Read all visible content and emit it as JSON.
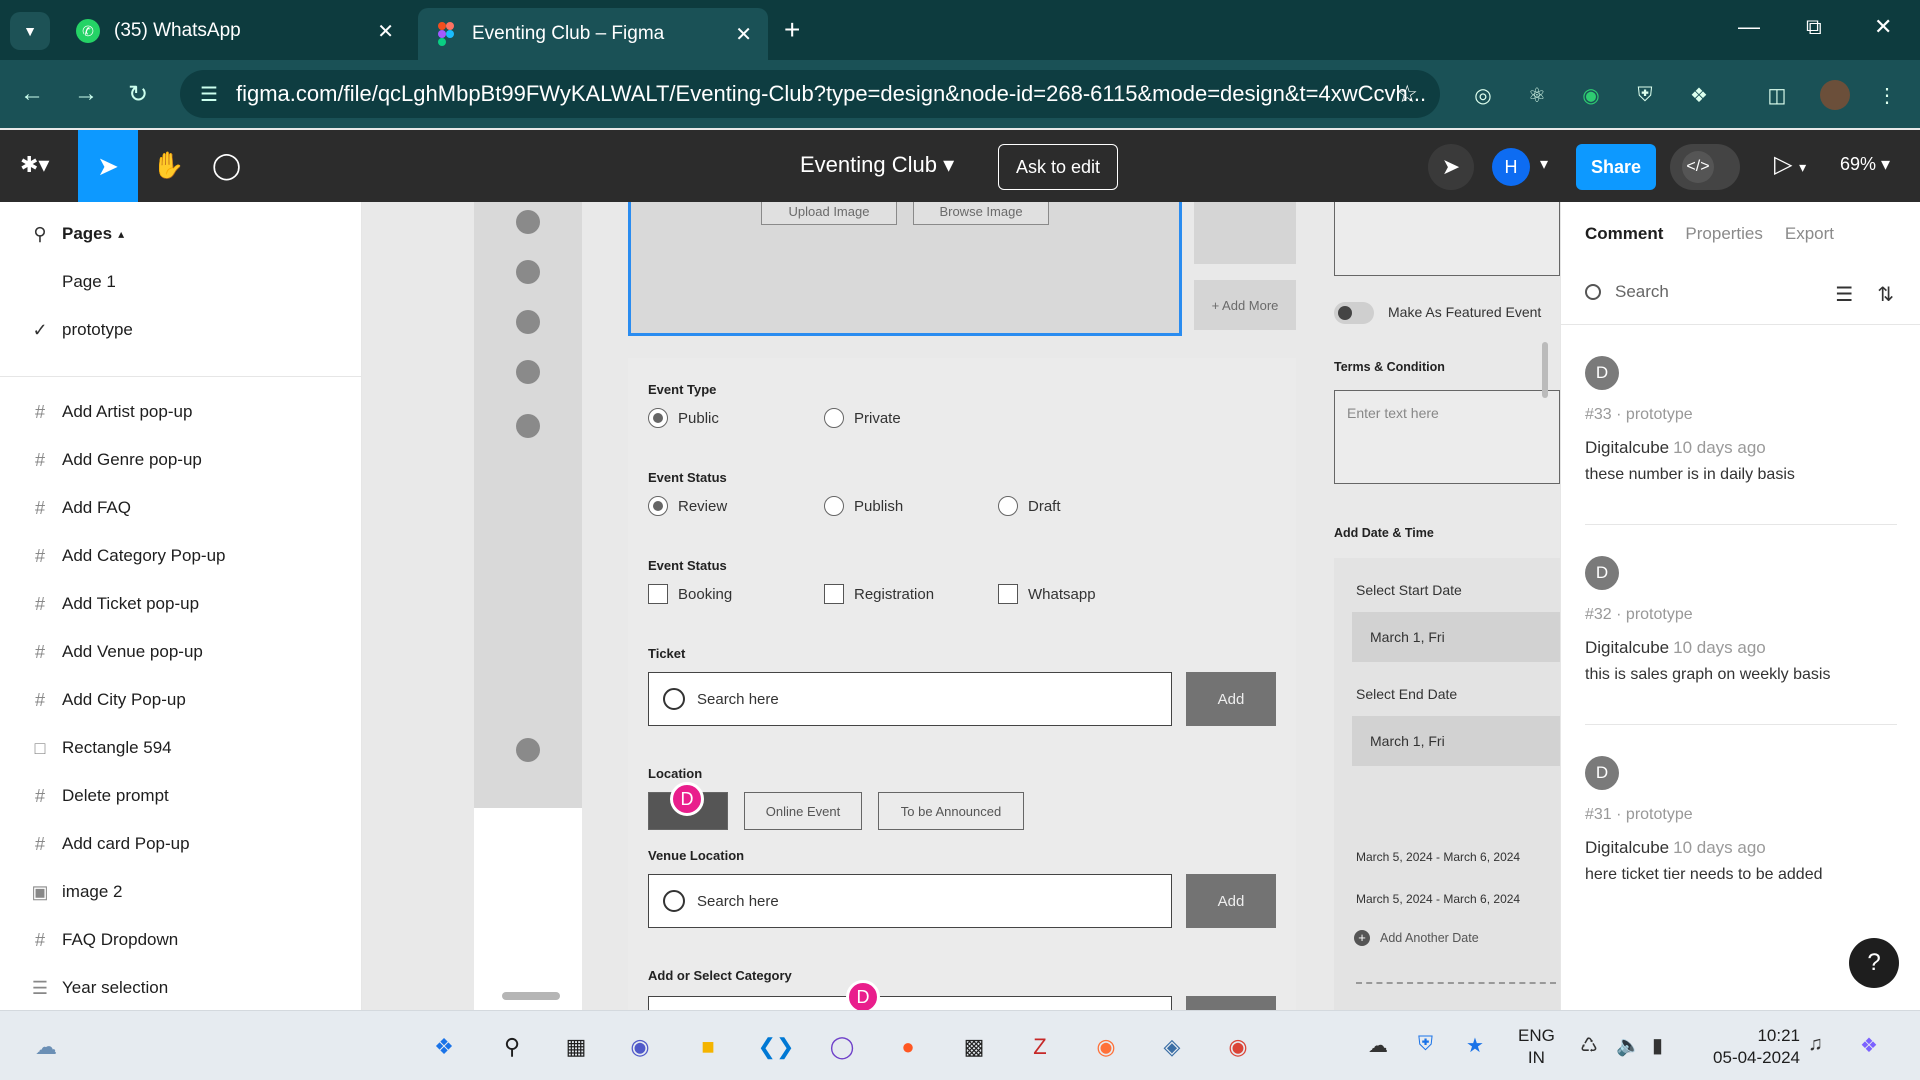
{
  "browser": {
    "tabs": [
      {
        "label": "(35) WhatsApp",
        "icon": "whatsapp-icon"
      },
      {
        "label": "Eventing Club – Figma",
        "icon": "figma-icon"
      }
    ],
    "url": "figma.com/file/qcLghMbpBt99FWyKALWALT/Eventing-Club?type=design&node-id=268-6115&mode=design&t=4xwCcvh..."
  },
  "figma": {
    "file_title": "Eventing Club",
    "ask_to_edit": "Ask to edit",
    "avatar_initial": "H",
    "share": "Share",
    "zoom": "69%"
  },
  "layers": {
    "pages_label": "Pages",
    "pages": [
      "Page 1",
      "prototype"
    ],
    "items": [
      {
        "label": "Add Artist pop-up",
        "icon": "frame-icon"
      },
      {
        "label": "Add Genre pop-up",
        "icon": "frame-icon"
      },
      {
        "label": "Add FAQ",
        "icon": "frame-icon"
      },
      {
        "label": "Add Category Pop-up",
        "icon": "frame-icon"
      },
      {
        "label": "Add Ticket pop-up",
        "icon": "frame-icon"
      },
      {
        "label": "Add Venue pop-up",
        "icon": "frame-icon"
      },
      {
        "label": "Add City Pop-up",
        "icon": "frame-icon"
      },
      {
        "label": "Rectangle 594",
        "icon": "rectangle-icon"
      },
      {
        "label": "Delete prompt",
        "icon": "frame-icon"
      },
      {
        "label": "Add card Pop-up",
        "icon": "frame-icon"
      },
      {
        "label": "image 2",
        "icon": "image-icon"
      },
      {
        "label": "FAQ Dropdown",
        "icon": "frame-icon"
      },
      {
        "label": "Year selection",
        "icon": "list-icon"
      }
    ]
  },
  "canvas": {
    "upload_image": "Upload Image",
    "browse_image": "Browse Image",
    "add_more": "+ Add More",
    "event_type_label": "Event Type",
    "event_type_options": [
      "Public",
      "Private"
    ],
    "event_status_label": "Event Status",
    "event_status_options": [
      "Review",
      "Publish",
      "Draft"
    ],
    "event_status2_label": "Event Status",
    "event_status2_options": [
      "Booking",
      "Registration",
      "Whatsapp"
    ],
    "ticket_label": "Ticket",
    "search_placeholder": "Search here",
    "add": "Add",
    "location_label": "Location",
    "location_options": [
      "Online Event",
      "To be Announced"
    ],
    "venue_label": "Venue Location",
    "category_label": "Add or Select Category",
    "cursor_initial": "D",
    "featured_label": "Make As Featured Event",
    "terms_label": "Terms & Condition",
    "terms_placeholder": "Enter text here",
    "date_time_label": "Add Date & Time",
    "start_date_label": "Select Start Date",
    "start_date_value": "March 1, Fri",
    "end_date_label": "Select End Date",
    "end_date_value": "March 1, Fri",
    "ranges": [
      "March 5, 2024 - March 6, 2024",
      "March 5, 2024 - March 6, 2024"
    ],
    "add_another_date": "Add Another Date"
  },
  "comments_panel": {
    "tabs": [
      "Comment",
      "Properties",
      "Export"
    ],
    "search_placeholder": "Search",
    "comments": [
      {
        "initial": "D",
        "ref": "#33 · prototype",
        "author": "Digitalcube",
        "ago": "10 days ago",
        "text": "these number is in daily basis"
      },
      {
        "initial": "D",
        "ref": "#32 · prototype",
        "author": "Digitalcube",
        "ago": "10 days ago",
        "text": "this is sales graph on weekly basis"
      },
      {
        "initial": "D",
        "ref": "#31 · prototype",
        "author": "Digitalcube",
        "ago": "10 days ago",
        "text": "here ticket tier needs to be added"
      }
    ],
    "help": "?"
  },
  "taskbar": {
    "lang_top": "ENG",
    "lang_bottom": "IN",
    "time": "10:21",
    "date": "05-04-2024"
  },
  "colors": {
    "browser_dark": "#0d3b3e",
    "figma_blue": "#0d99ff",
    "cursor_pink": "#e91e8c"
  }
}
